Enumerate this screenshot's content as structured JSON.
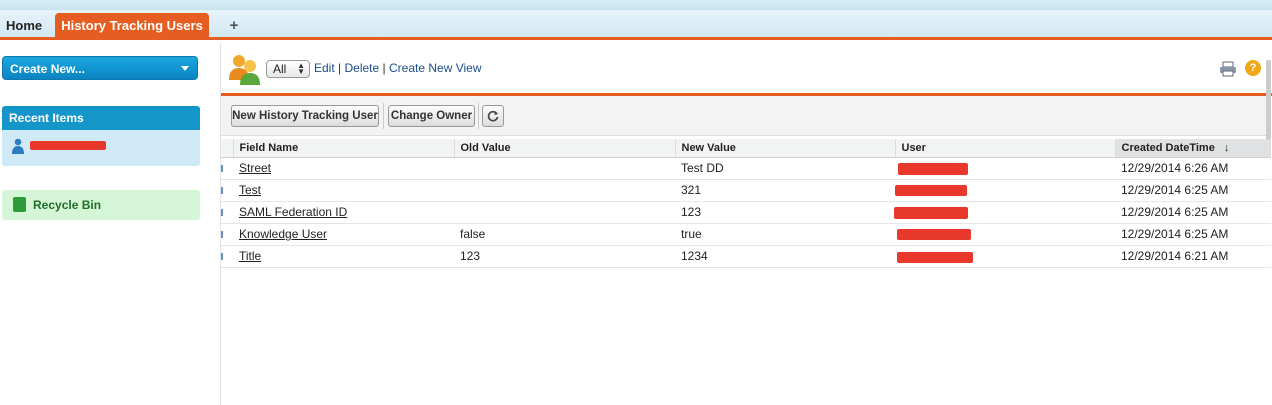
{
  "tabs": {
    "home": "Home",
    "active": "History Tracking Users",
    "plus": "+"
  },
  "sidebar": {
    "create_label": "Create New...",
    "recent_header": "Recent Items",
    "recycle_label": "Recycle Bin"
  },
  "view": {
    "selected": "All",
    "edit": "Edit",
    "delete": "Delete",
    "create": "Create New View",
    "sep": "|"
  },
  "toolbar": {
    "new_label": "New History Tracking User",
    "owner_label": "Change Owner"
  },
  "table": {
    "columns": [
      "Field Name",
      "Old Value",
      "New Value",
      "User",
      "Created DateTime"
    ],
    "sort_indicator": "↓",
    "rows": [
      {
        "field": "Street",
        "old": "",
        "new": "Test DD",
        "created": "12/29/2014 6:26 AM"
      },
      {
        "field": "Test",
        "old": "",
        "new": "321",
        "created": "12/29/2014 6:25 AM"
      },
      {
        "field": "SAML Federation ID",
        "old": "",
        "new": "123",
        "created": "12/29/2014 6:25 AM"
      },
      {
        "field": "Knowledge User",
        "old": "false",
        "new": "true",
        "created": "12/29/2014 6:25 AM"
      },
      {
        "field": "Title",
        "old": "123",
        "new": "1234",
        "created": "12/29/2014 6:21 AM"
      }
    ]
  },
  "colors": {
    "accent": "#e65d22",
    "brand_blue": "#1596c9",
    "redaction": "#e8372b"
  },
  "icons": [
    "users-icon",
    "person-icon",
    "recycle-bin-icon",
    "print-icon",
    "help-icon",
    "refresh-icon",
    "chevron-down-icon"
  ]
}
